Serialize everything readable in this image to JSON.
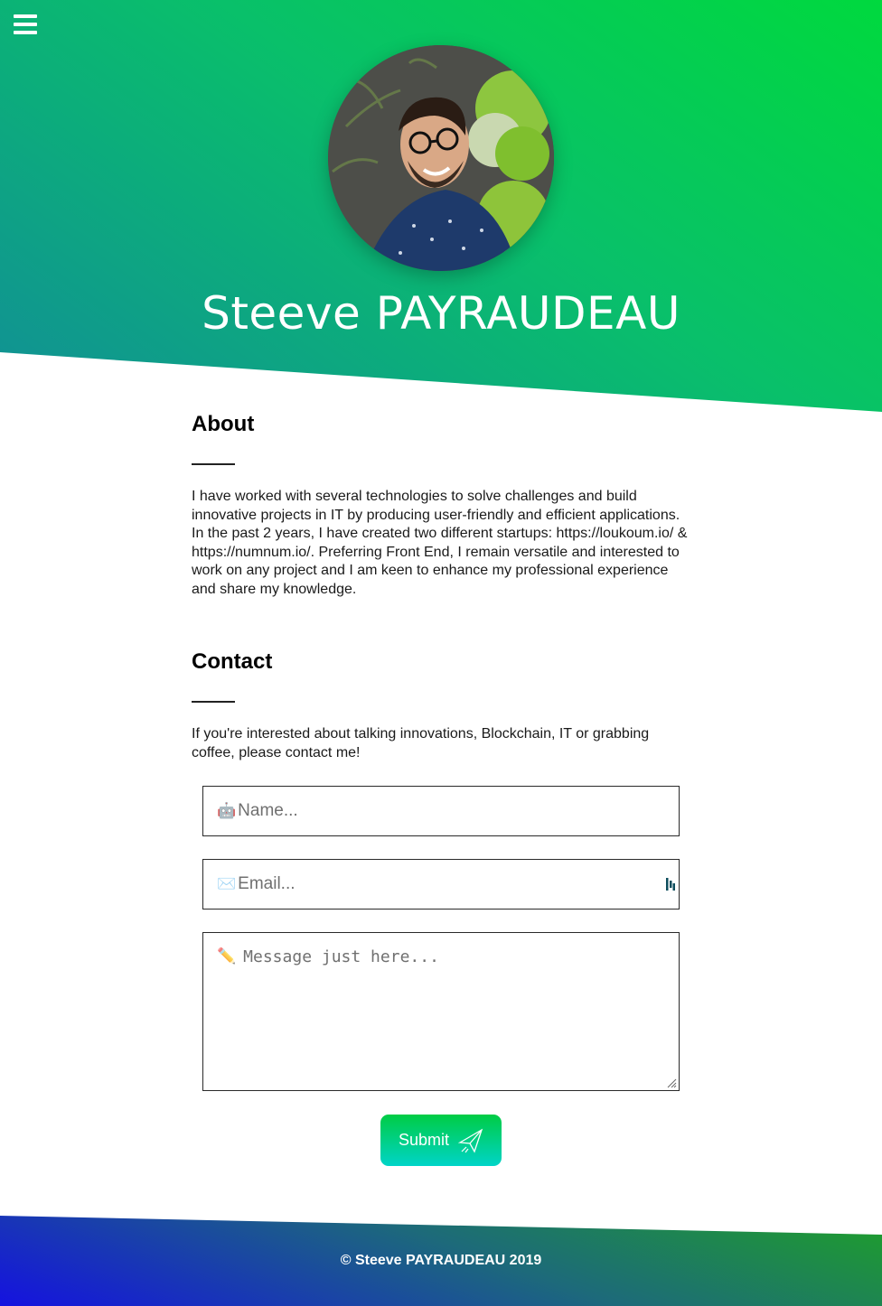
{
  "header": {
    "menu_icon": "hamburger-menu-icon",
    "name": "Steeve PAYRAUDEAU"
  },
  "about": {
    "title": "About",
    "text": "I have worked with several technologies to solve challenges and build innovative projects in IT by producing user-friendly and efficient applications. In the past 2 years, I have created two different startups: https://loukoum.io/ & https://numnum.io/. Preferring Front End, I remain versatile and interested to work on any project and I am keen to enhance my professional experience and share my knowledge."
  },
  "contact": {
    "title": "Contact",
    "text": "If you're interested about talking innovations, Blockchain, IT or grabbing coffee, please contact me!",
    "name_placeholder": "Name...",
    "email_placeholder": "Email...",
    "message_placeholder": "Message just here...",
    "name_icon": "🤖",
    "email_icon": "✉️",
    "message_icon": "✏️",
    "submit_label": "Submit"
  },
  "footer": {
    "text": "© Steeve PAYRAUDEAU 2019"
  },
  "colors": {
    "hero_gradient": [
      "#00d93e",
      "#118f96"
    ],
    "submit_gradient": [
      "#00cc44",
      "#00d4c8"
    ],
    "footer_gradient": [
      "#1e9f2a",
      "#1512e0"
    ]
  }
}
